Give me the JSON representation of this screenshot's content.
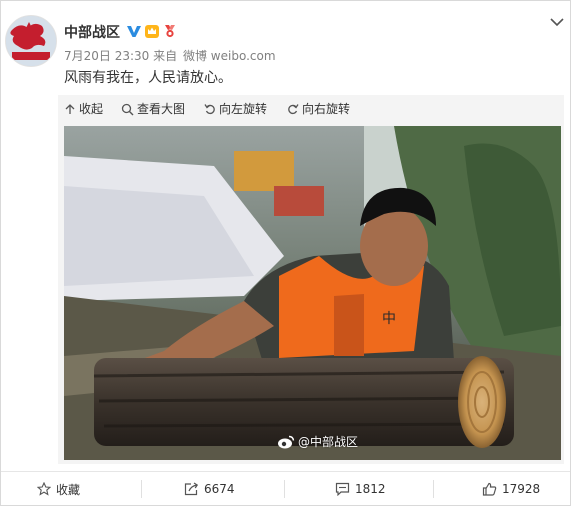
{
  "post": {
    "author": "中部战区",
    "avatar_text": "中部战区",
    "date": "7月20日 23:30",
    "source_prefix": "来自",
    "source": "微博 weibo.com",
    "text": "风雨有我在，人民请放心。"
  },
  "media_toolbar": {
    "collapse": "收起",
    "view_large": "查看大图",
    "rotate_left": "向左旋转",
    "rotate_right": "向右旋转"
  },
  "photo": {
    "watermark": "@中部战区",
    "vest_text": "中"
  },
  "actions": {
    "favorite": "收藏",
    "repost_count": "6674",
    "comment_count": "1812",
    "like_count": "17928"
  },
  "colors": {
    "accent": "#ff8200",
    "vip_blue": "#2b8ce0",
    "avatar_red": "#c41e2e"
  }
}
